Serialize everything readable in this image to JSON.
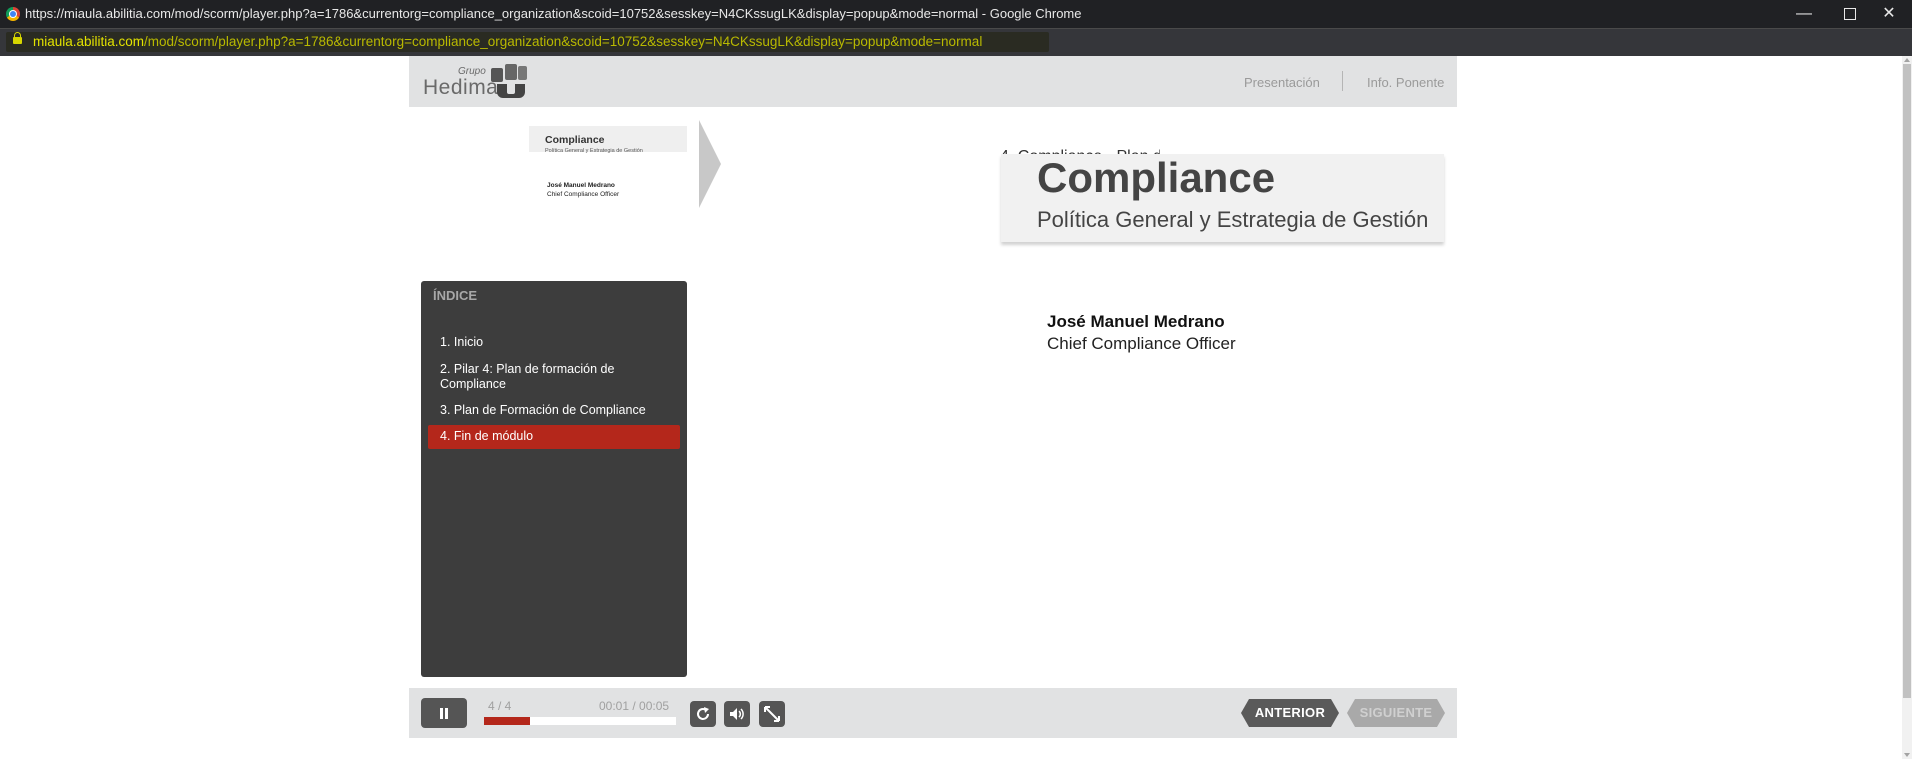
{
  "browser": {
    "window_title": "https://miaula.abilitia.com/mod/scorm/player.php?a=1786&currentorg=compliance_organization&scoid=10752&sesskey=N4CKssugLK&display=popup&mode=normal - Google Chrome",
    "url_host": "miaula.abilitia.com",
    "url_path": "/mod/scorm/player.php?a=1786&currentorg=compliance_organization&scoid=10752&sesskey=N4CKssugLK&display=popup&mode=normal",
    "controls": {
      "minimize": "—",
      "close": "✕"
    }
  },
  "header": {
    "logo_grupo": "Grupo",
    "logo_hedima": "Hedima",
    "links": {
      "presentacion": "Presentación",
      "ponente": "Info. Ponente"
    }
  },
  "thumbnail": {
    "title": "Compliance",
    "subtitle": "Política General y Estrategia de Gestión",
    "name": "José Manuel Medrano",
    "role": "Chief Compliance Officer"
  },
  "slide": {
    "title": "Compliance",
    "subtitle": "Política General y Estrategia de Gestión",
    "ghost_text": "4. Compliance - Plan de formación de Compliance",
    "speaker_name": "José Manuel Medrano",
    "speaker_role": "Chief Compliance Officer"
  },
  "index": {
    "title": "ÍNDICE",
    "items": [
      {
        "label": "1. Inicio"
      },
      {
        "label": "2. Pilar 4: Plan de formación de Compliance"
      },
      {
        "label": "3. Plan de Formación de Compliance"
      },
      {
        "label": "4. Fin de módulo",
        "active": true
      }
    ]
  },
  "player": {
    "slide_counter": "4 / 4",
    "time": "00:01 / 00:05",
    "progress_fraction": 0.24,
    "prev_label": "ANTERIOR",
    "next_label": "SIGUIENTE"
  },
  "colors": {
    "accent": "#b4271b",
    "panel": "#3d3d3d",
    "header_bg": "#e1e2e3"
  }
}
